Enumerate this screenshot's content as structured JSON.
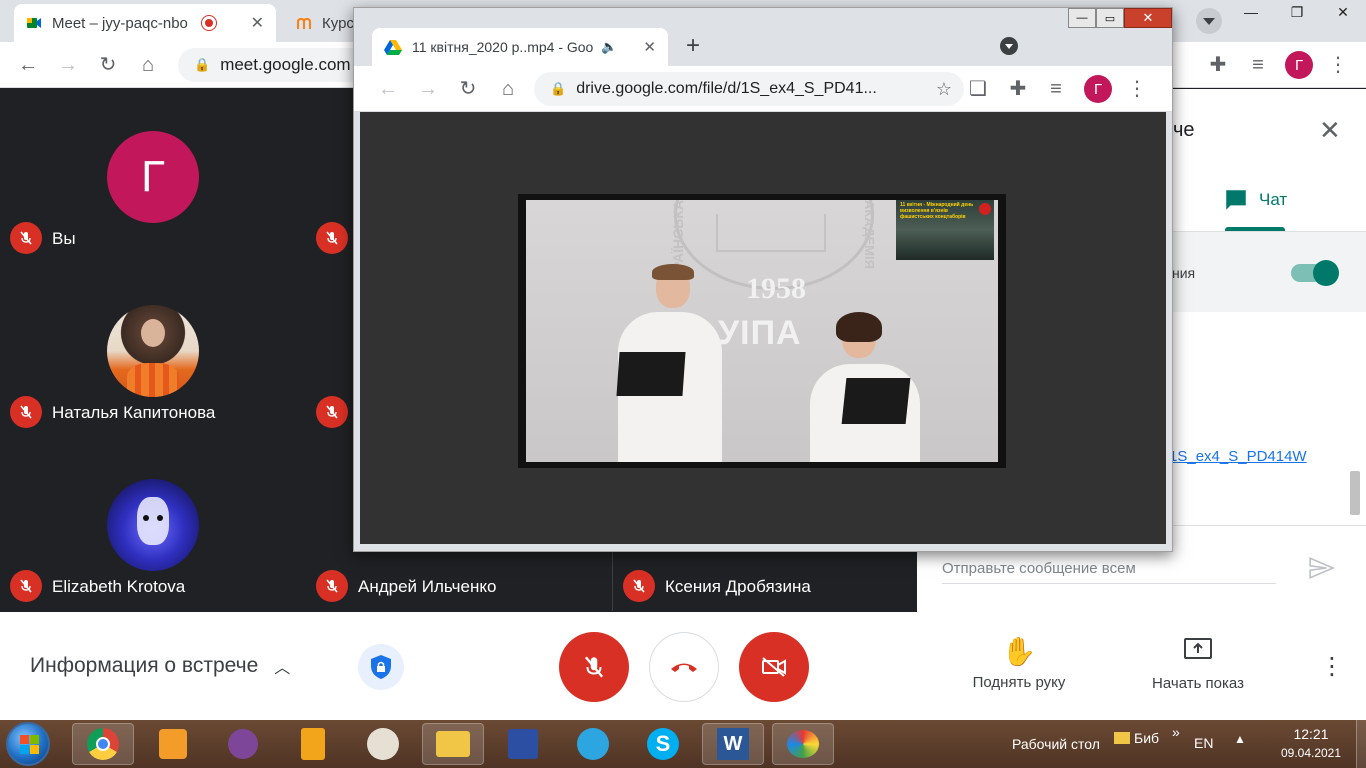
{
  "main_window": {
    "tabs": [
      {
        "title": "Meet – jyy-paqc-nbo",
        "icon": "meet-icon"
      },
      {
        "title": "Курс",
        "icon": "moodle-icon"
      }
    ],
    "address": "meet.google.com",
    "profile_initial": "Г"
  },
  "participants": [
    {
      "name": "Вы",
      "avatar_initial": "Г",
      "avatar_color": "#c2185b"
    },
    {
      "name": "Наталья Капитонова",
      "avatar_type": "photo-flowers"
    },
    {
      "name": "Elizabeth Krotova",
      "avatar_type": "photo-cat"
    },
    {
      "name": "Андрей Ильченко"
    },
    {
      "name": "Ксения Дробязина"
    }
  ],
  "panel": {
    "title_fragment": "че",
    "chat_tab": "Чат",
    "toggle_fragment": "ния",
    "link_fragment": "1S_ex4_S_PD414W",
    "message_placeholder": "Отправьте сообщение всем"
  },
  "bottom_bar": {
    "meeting_info": "Информация о встрече",
    "raise_hand": "Поднять руку",
    "present": "Начать показ"
  },
  "popup": {
    "tab_title": "11 квітня_2020 р..mp4 - Goo",
    "address": "drive.google.com/file/d/1S_ex4_S_PD41...",
    "profile_initial": "Г",
    "video": {
      "year": "1958",
      "logo": "УІПА",
      "seal_left": "УКРАЇНСЬКА",
      "seal_right": "АКАДЕМІЯ",
      "poster_text": "11 квітня - Міжнародний день визволення в'язнів фашистських концтаборів"
    }
  },
  "taskbar": {
    "desktop_label": "Рабочий стол",
    "folder_label": "Биб",
    "lang": "EN",
    "time": "12:21",
    "date": "09.04.2021"
  },
  "colors": {
    "meet_bg": "#202124",
    "mic_off": "#d93025",
    "accent_green": "#00796b",
    "avatar": "#c2185b"
  }
}
